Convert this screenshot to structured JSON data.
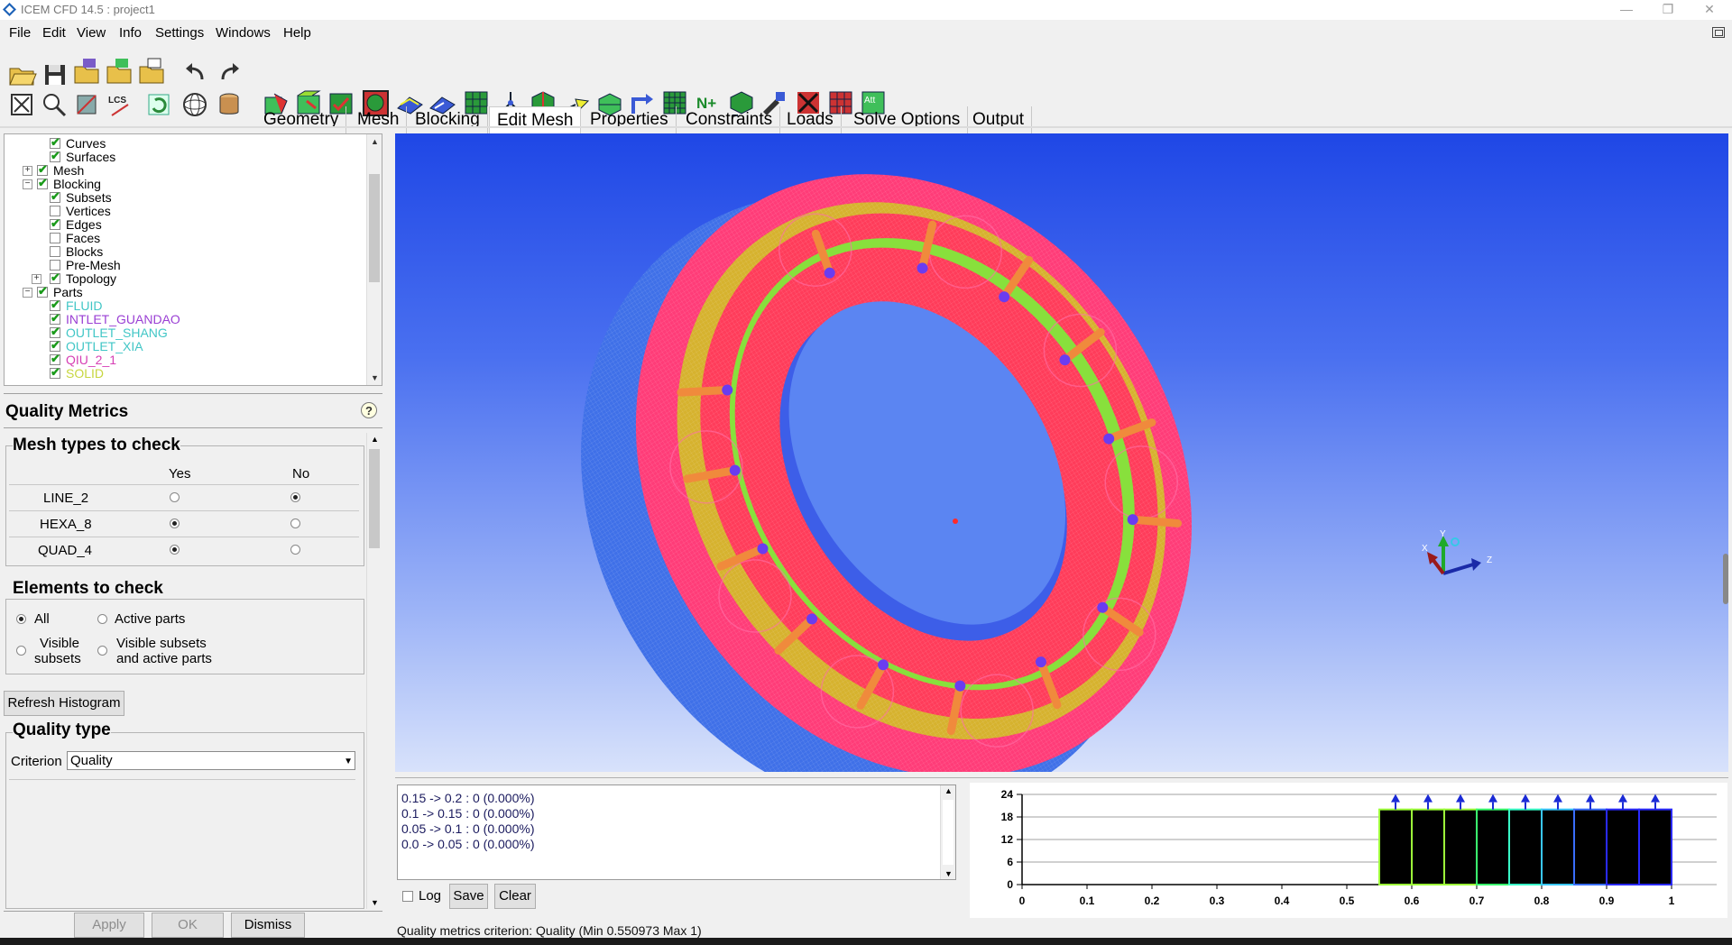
{
  "window": {
    "title": "ICEM CFD 14.5 : project1"
  },
  "menu": [
    "File",
    "Edit",
    "View",
    "Info",
    "Settings",
    "Windows",
    "Help"
  ],
  "tabs": [
    "Geometry",
    "Mesh",
    "Blocking",
    "Edit Mesh",
    "Properties",
    "Constraints",
    "Loads",
    "Solve Options",
    "Output"
  ],
  "active_tab": "Edit Mesh",
  "tree": {
    "items": [
      {
        "label": "Curves",
        "checked": true
      },
      {
        "label": "Surfaces",
        "checked": true
      },
      {
        "label": "Mesh",
        "checked": true
      },
      {
        "label": "Blocking",
        "checked": true
      },
      {
        "label": "Subsets",
        "checked": true
      },
      {
        "label": "Vertices",
        "checked": false
      },
      {
        "label": "Edges",
        "checked": true
      },
      {
        "label": "Faces",
        "checked": false
      },
      {
        "label": "Blocks",
        "checked": false
      },
      {
        "label": "Pre-Mesh",
        "checked": false
      },
      {
        "label": "Topology",
        "checked": true
      },
      {
        "label": "Parts",
        "checked": true
      },
      {
        "label": "FLUID",
        "checked": true,
        "color": "#41c6c6"
      },
      {
        "label": "INTLET_GUANDAO",
        "checked": true,
        "color": "#9a3fd4"
      },
      {
        "label": "OUTLET_SHANG",
        "checked": true,
        "color": "#41c6c6"
      },
      {
        "label": "OUTLET_XIA",
        "checked": true,
        "color": "#41c6c6"
      },
      {
        "label": "QIU_2_1",
        "checked": true,
        "color": "#d63fb4"
      },
      {
        "label": "SOLID",
        "checked": true,
        "color": "#c7d63f"
      }
    ]
  },
  "quality_metrics": {
    "title": "Quality Metrics",
    "mesh_types": {
      "title": "Mesh types to check",
      "col_yes": "Yes",
      "col_no": "No",
      "rows": [
        {
          "label": "LINE_2",
          "yes": false
        },
        {
          "label": "HEXA_8",
          "yes": true
        },
        {
          "label": "QUAD_4",
          "yes": true
        }
      ]
    },
    "elements": {
      "title": "Elements to check",
      "opt_all": "All",
      "opt_active": "Active parts",
      "opt_visible_1": "Visible",
      "opt_visible_2": "subsets",
      "opt_visible_active_1": "Visible subsets",
      "opt_visible_active_2": "and active parts"
    },
    "refresh_label": "Refresh Histogram",
    "quality_type": {
      "title": "Quality type",
      "criterion_label": "Criterion",
      "criterion_value": "Quality"
    },
    "apply_label": "Apply",
    "ok_label": "OK",
    "dismiss_label": "Dismiss"
  },
  "log": {
    "lines": [
      "0.15 -> 0.2 : 0 (0.000%)",
      "0.1 -> 0.15 : 0 (0.000%)",
      "0.05 -> 0.1 : 0 (0.000%)",
      "0.0 -> 0.05 : 0 (0.000%)"
    ],
    "log_label": "Log",
    "save_label": "Save",
    "clear_label": "Clear"
  },
  "axes_triad": {
    "x": "X",
    "y": "Y",
    "z": "Z"
  },
  "chart_data": {
    "type": "bar",
    "xlim": [
      0,
      1
    ],
    "ylim": [
      0,
      24
    ],
    "y_ticks": [
      0,
      6,
      12,
      18,
      24
    ],
    "x_ticks": [
      "0",
      "0.1",
      "0.2",
      "0.3",
      "0.4",
      "0.5",
      "0.6",
      "0.7",
      "0.8",
      "0.9",
      "1"
    ],
    "bins": [
      {
        "from": 0.55,
        "to": 0.6,
        "value": 20
      },
      {
        "from": 0.6,
        "to": 0.65,
        "value": 20
      },
      {
        "from": 0.65,
        "to": 0.7,
        "value": 20
      },
      {
        "from": 0.7,
        "to": 0.75,
        "value": 20
      },
      {
        "from": 0.75,
        "to": 0.8,
        "value": 20
      },
      {
        "from": 0.8,
        "to": 0.85,
        "value": 20
      },
      {
        "from": 0.85,
        "to": 0.9,
        "value": 20
      },
      {
        "from": 0.9,
        "to": 0.95,
        "value": 20
      },
      {
        "from": 0.95,
        "to": 1.0,
        "value": 20
      }
    ],
    "bar_fill": "#000000",
    "bar_edges": [
      "#9dff3a",
      "#9dff3a",
      "#9dff3a",
      "#3aff6e",
      "#3affc8",
      "#3ac8ff",
      "#3a6eff",
      "#2a2aff",
      "#2a2aff"
    ]
  },
  "status": "Quality metrics criterion: Quality (Min 0.550973 Max 1)"
}
